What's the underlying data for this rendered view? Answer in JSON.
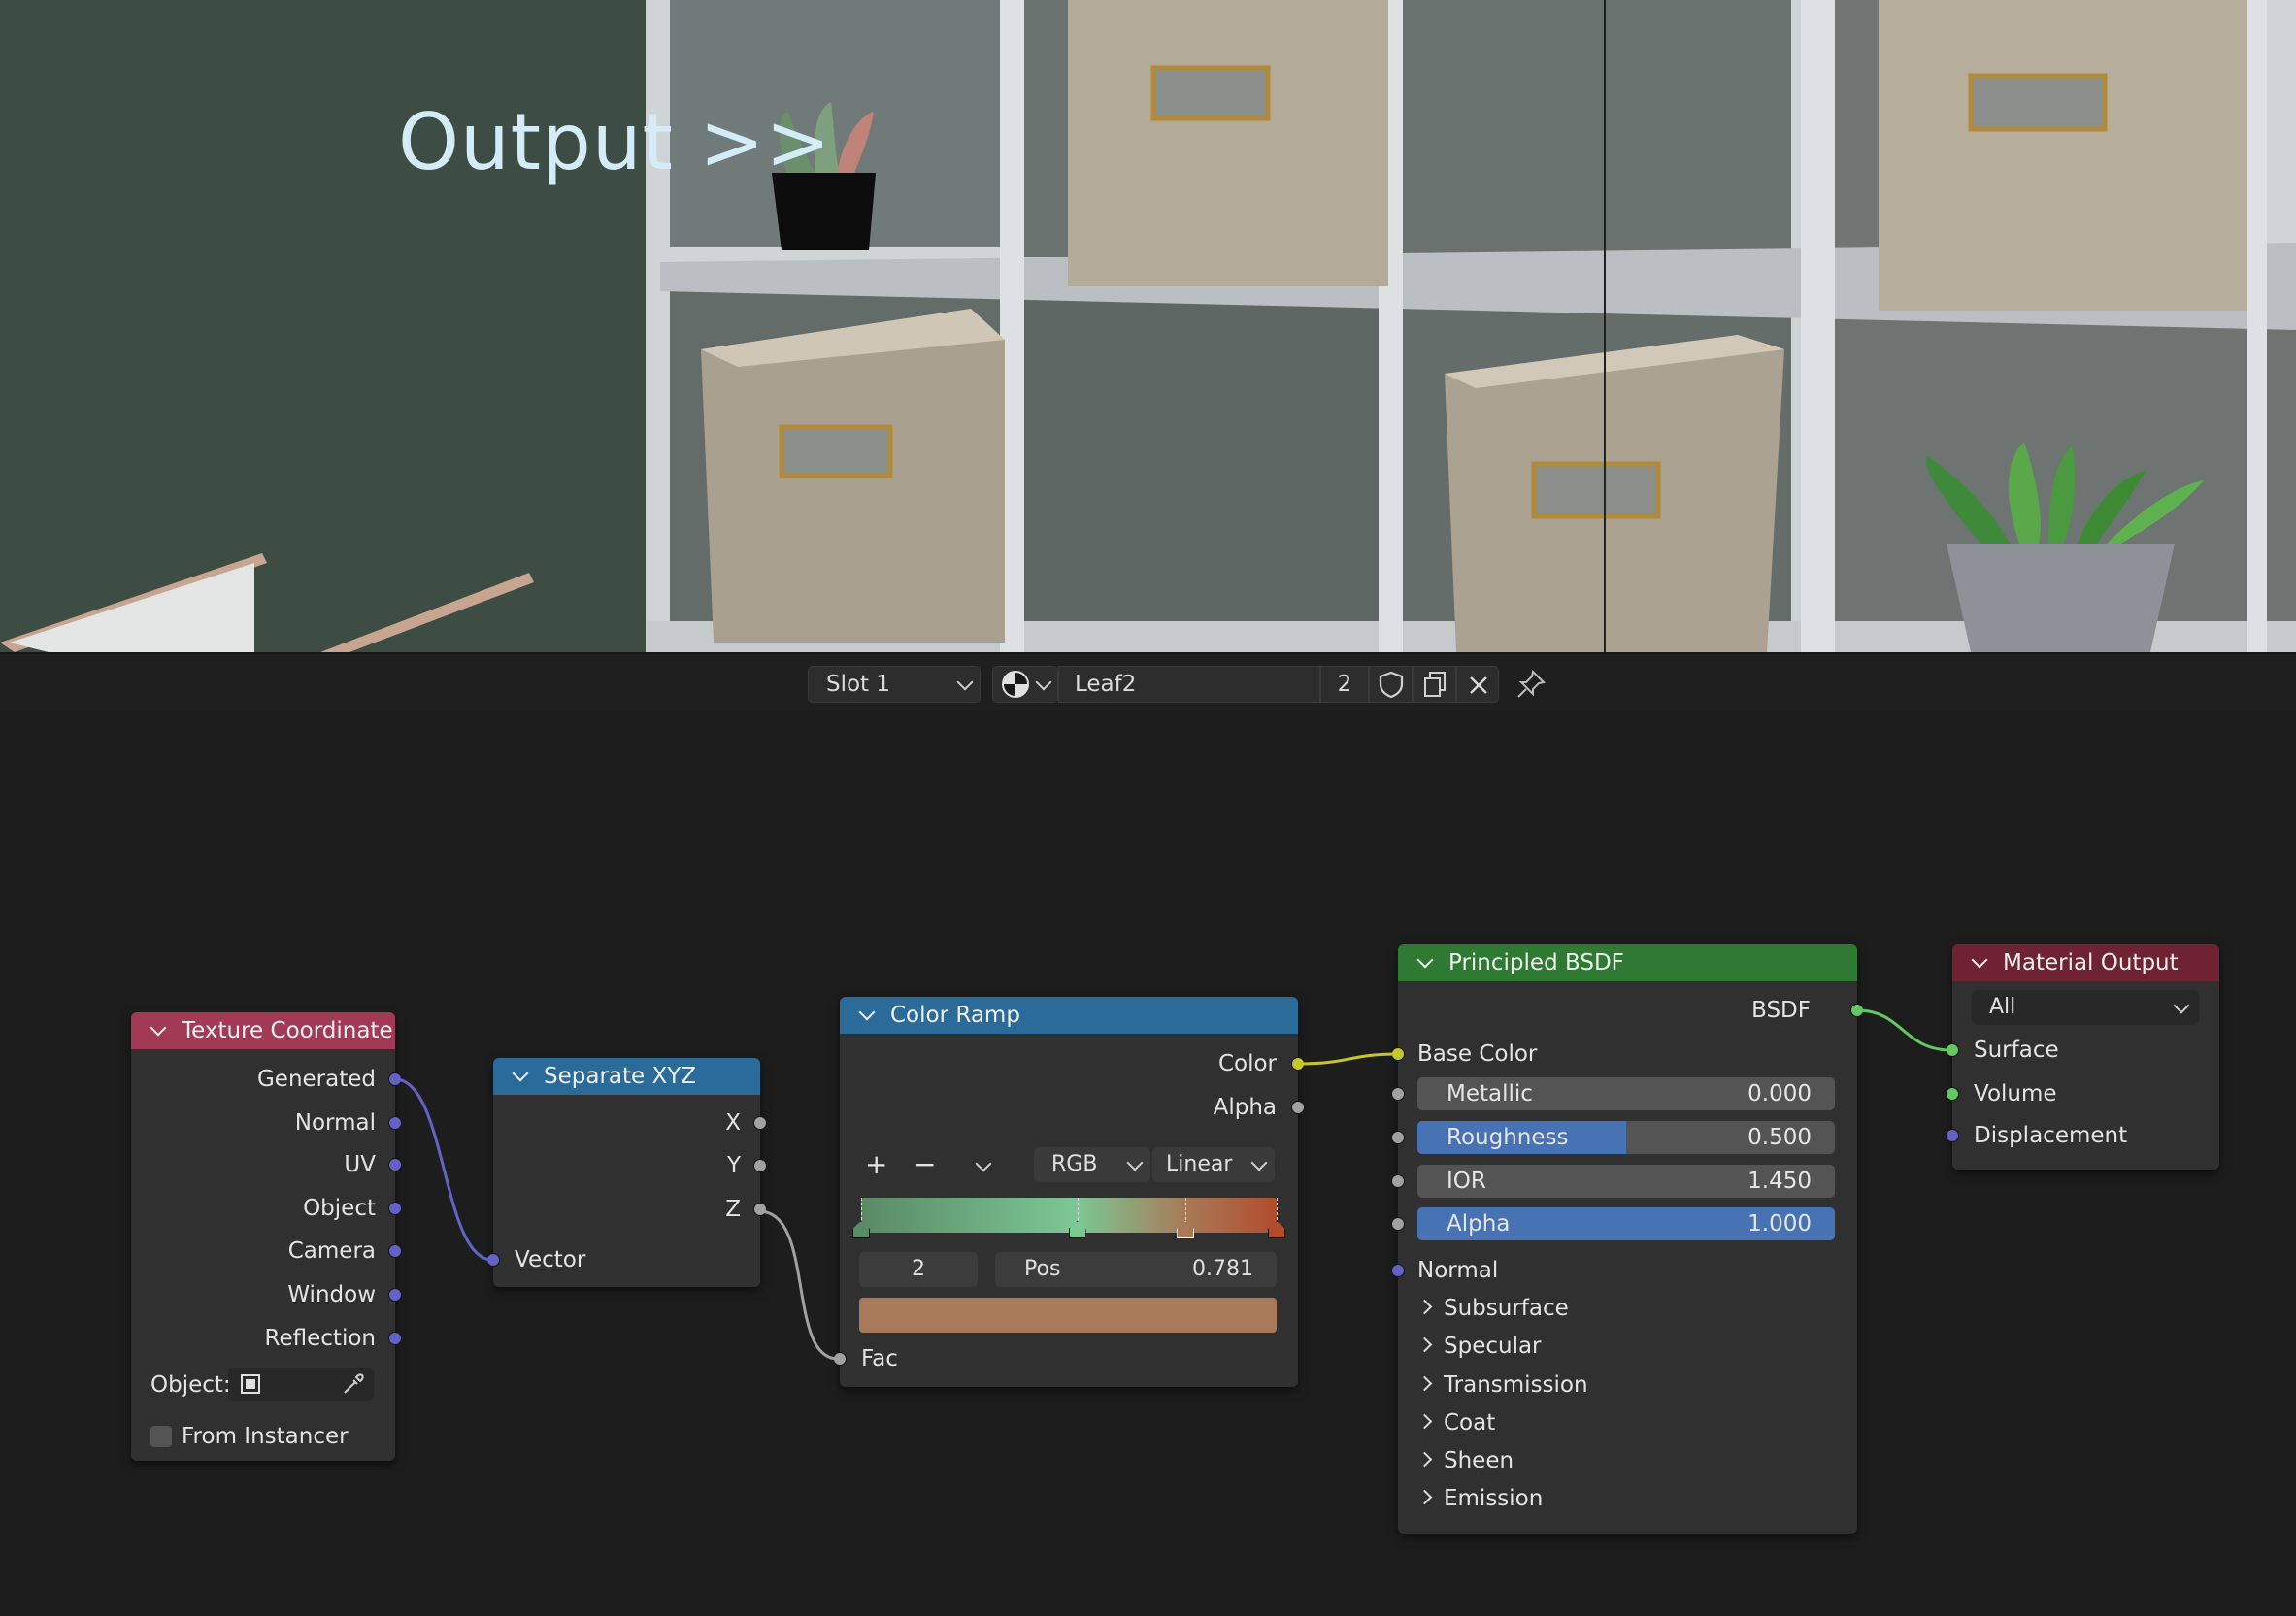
{
  "viewport": {
    "overlay_text": "Output >>"
  },
  "header": {
    "slot_label": "Slot 1",
    "material_icon": "material-sphere-icon",
    "material_name": "Leaf2",
    "user_count": "2",
    "fake_user_icon": "shield-icon",
    "duplicate_icon": "duplicate-icon",
    "unlink_icon": "close-icon",
    "pin_icon": "pin-icon"
  },
  "nodes": {
    "texture_coordinate": {
      "title": "Texture Coordinate",
      "header_color": "#a33a55",
      "outputs": [
        "Generated",
        "Normal",
        "UV",
        "Object",
        "Camera",
        "Window",
        "Reflection"
      ],
      "object_label": "Object:",
      "from_instancer_label": "From Instancer",
      "from_instancer_checked": false
    },
    "separate_xyz": {
      "title": "Separate XYZ",
      "header_color": "#2a6b99",
      "outputs": [
        "X",
        "Y",
        "Z"
      ],
      "input": "Vector"
    },
    "color_ramp": {
      "title": "Color Ramp",
      "header_color": "#2a6b99",
      "outputs": [
        "Color",
        "Alpha"
      ],
      "add_label": "+",
      "remove_label": "−",
      "color_mode": "RGB",
      "interpolation": "Linear",
      "active_stop_index": "2",
      "pos_label": "Pos",
      "pos_value": "0.781",
      "active_color": "#a87a59",
      "input": "Fac",
      "stops": [
        {
          "position": 0.0,
          "color": "#5a8a66"
        },
        {
          "position": 0.52,
          "color": "#7cc894"
        },
        {
          "position": 0.781,
          "color": "#a87a59"
        },
        {
          "position": 1.0,
          "color": "#b24c2c"
        }
      ]
    },
    "principled_bsdf": {
      "title": "Principled BSDF",
      "header_color": "#2e7a32",
      "output": "BSDF",
      "base_color_label": "Base Color",
      "metallic": {
        "label": "Metallic",
        "value": "0.000",
        "fraction": 0.0
      },
      "roughness": {
        "label": "Roughness",
        "value": "0.500",
        "fraction": 0.5
      },
      "ior": {
        "label": "IOR",
        "value": "1.450",
        "fraction": 0.0
      },
      "alpha": {
        "label": "Alpha",
        "value": "1.000",
        "fraction": 1.0
      },
      "normal_label": "Normal",
      "panels": [
        "Subsurface",
        "Specular",
        "Transmission",
        "Coat",
        "Sheen",
        "Emission"
      ]
    },
    "material_output": {
      "title": "Material Output",
      "header_color": "#6e2232",
      "target": "All",
      "inputs": [
        "Surface",
        "Volume",
        "Displacement"
      ]
    }
  },
  "colors": {
    "socket_vector": "#6363c7",
    "socket_float": "#a1a1a1",
    "socket_color": "#c7c729",
    "socket_shader": "#63c763",
    "slider_fill": "#4772b3"
  }
}
